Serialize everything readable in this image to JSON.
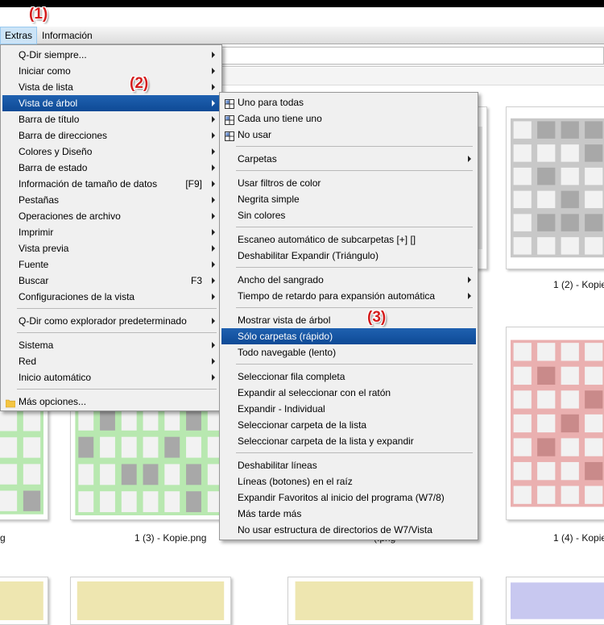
{
  "annotations": [
    "(1)",
    "(2)",
    "(3)"
  ],
  "menubar": {
    "items": [
      "Extras",
      "Información"
    ]
  },
  "extras_menu": {
    "items": [
      {
        "label": "Q-Dir siempre...",
        "submenu": true
      },
      {
        "label": "Iniciar como",
        "submenu": true
      },
      {
        "label": "Vista de lista",
        "submenu": true
      },
      {
        "label": "Vista de árbol",
        "submenu": true,
        "highlighted": true
      },
      {
        "label": "Barra de título",
        "submenu": true
      },
      {
        "label": "Barra de direcciones",
        "submenu": true
      },
      {
        "label": "Colores y Diseño",
        "submenu": true
      },
      {
        "label": "Barra de estado",
        "submenu": true
      },
      {
        "label": "Información de tamaño de datos",
        "shortcut": "[F9]",
        "submenu": true
      },
      {
        "label": "Pestañas",
        "submenu": true
      },
      {
        "label": "Operaciones de archivo",
        "submenu": true
      },
      {
        "label": "Imprimir",
        "submenu": true
      },
      {
        "label": "Vista previa",
        "submenu": true
      },
      {
        "label": "Fuente",
        "submenu": true
      },
      {
        "label": "Buscar",
        "shortcut": "F3",
        "submenu": true
      },
      {
        "label": "Configuraciones de la vista",
        "submenu": true
      },
      {
        "separator": true
      },
      {
        "label": "Q-Dir como explorador predeterminado",
        "submenu": true
      },
      {
        "separator": true
      },
      {
        "label": "Sistema",
        "submenu": true
      },
      {
        "label": "Red",
        "submenu": true
      },
      {
        "label": "Inicio automático",
        "submenu": true
      },
      {
        "separator": true
      },
      {
        "label": "Más opciones...",
        "icon": "folder-icon"
      }
    ]
  },
  "tree_submenu": {
    "items": [
      {
        "label": "Uno para todas",
        "icon": "layout-grid-icon"
      },
      {
        "label": "Cada uno tiene uno",
        "icon": "layout-grid-icon"
      },
      {
        "label": "No usar",
        "icon": "layout-grid-icon"
      },
      {
        "separator": true
      },
      {
        "label": "Carpetas",
        "submenu": true
      },
      {
        "separator": true
      },
      {
        "label": "Usar filtros de color"
      },
      {
        "label": "Negrita simple"
      },
      {
        "label": "Sin colores"
      },
      {
        "separator": true
      },
      {
        "label": "Escaneo automático de subcarpetas [+] []"
      },
      {
        "label": "Deshabilitar Expandir (Triángulo)"
      },
      {
        "separator": true
      },
      {
        "label": "Ancho del sangrado",
        "submenu": true
      },
      {
        "label": "Tiempo de retardo para expansión automática",
        "submenu": true
      },
      {
        "separator": true
      },
      {
        "label": "Mostrar vista de árbol"
      },
      {
        "label": "Sólo carpetas (rápido)",
        "highlighted": true
      },
      {
        "label": "Todo navegable (lento)"
      },
      {
        "separator": true
      },
      {
        "label": "Seleccionar fila completa"
      },
      {
        "label": "Expandir al seleccionar con el ratón"
      },
      {
        "label": "Expandir - Individual"
      },
      {
        "label": "Seleccionar carpeta de la lista"
      },
      {
        "label": "Seleccionar carpeta de la lista y expandir"
      },
      {
        "separator": true
      },
      {
        "label": "Deshabilitar líneas"
      },
      {
        "label": "Líneas (botones) en el raíz"
      },
      {
        "label": "Expandir Favoritos al inicio del programa (W7/8)"
      },
      {
        "label": "Más tarde más"
      },
      {
        "label": "No usar estructura de directorios de W7/Vista"
      }
    ]
  },
  "files": {
    "captions": [
      "1 (2) - Kopie",
      "1 (3) - Kopie.png",
      "1 (4) - Kopie",
      "g",
      "(.png"
    ]
  },
  "colors": {
    "menu_highlight": "#0e4a96",
    "annotation": "#d41c1c",
    "thumb_gray": "#c8c8c8",
    "thumb_green": "#b8e8b0",
    "thumb_red": "#eab0b0",
    "thumb_yellow": "#eee6b0",
    "thumb_blue": "#c8c8f0"
  }
}
